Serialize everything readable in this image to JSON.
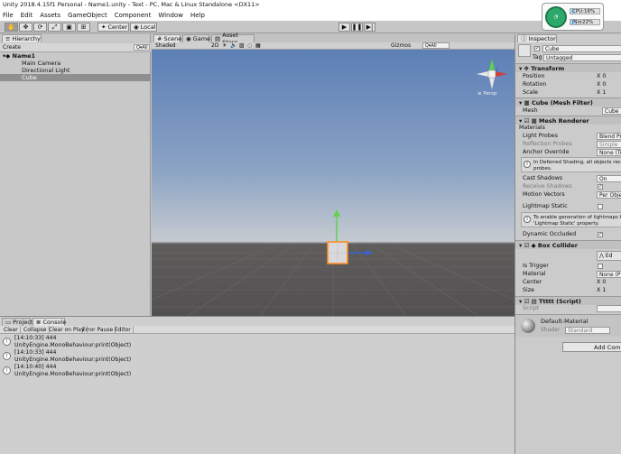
{
  "window": {
    "title": "Unity 2018.4.15f1 Personal - Name1.unity - Text - PC, Mac & Linux Standalone <DX11>"
  },
  "menu": [
    "File",
    "Edit",
    "Assets",
    "GameObject",
    "Component",
    "Window",
    "Help"
  ],
  "toolbar": {
    "pivot_mode": "Center",
    "pivot_rotation": "Local"
  },
  "sysmon": {
    "cpu": "CPU:16%",
    "mem": "内存22%",
    "cpu_value": 16,
    "mem_value": 22,
    "gauge_color": "#2ea86a"
  },
  "hierarchy": {
    "tab": "Hierarchy",
    "create": "Create",
    "search": "Q▾All",
    "scene": "Name1",
    "items": [
      "Main Camera",
      "Directional Light",
      "Cube"
    ]
  },
  "scene_view": {
    "tabs": [
      "Scene",
      "Game",
      "Asset Store"
    ],
    "shading": "Shaded",
    "mode_2d": "2D",
    "gizmos": "Gizmos",
    "search": "Q▾All",
    "persp": "≡ Persp"
  },
  "console": {
    "tabs": [
      "Project",
      "Console"
    ],
    "buttons": [
      "Clear",
      "Collapse",
      "Clear on Play",
      "Error Pause",
      "Editor"
    ],
    "logs": [
      {
        "line1": "[14:10:33] 444",
        "line2": "UnityEngine.MonoBehaviour:print(Object)"
      },
      {
        "line1": "[14:10:33] 444",
        "line2": "UnityEngine.MonoBehaviour:print(Object)"
      },
      {
        "line1": "[14:10:40] 444",
        "line2": "UnityEngine.MonoBehaviour:print(Object)"
      }
    ]
  },
  "inspector": {
    "tab": "Inspector",
    "object_name": "Cube",
    "tag_label": "Tag",
    "tag_value": "Untagged",
    "transform": {
      "title": "Transform",
      "position": "Position",
      "rotation": "Rotation",
      "scale": "Scale",
      "x0": "X 0",
      "x1": "X 1"
    },
    "mesh_filter": {
      "title": "Cube (Mesh Filter)",
      "mesh_label": "Mesh",
      "mesh_value": "Cube"
    },
    "mesh_renderer": {
      "title": "Mesh Renderer",
      "materials": "Materials",
      "light_probes": "Light Probes",
      "light_probes_val": "Blend Pr",
      "reflection_probes": "Reflection Probes",
      "reflection_val": "Simple",
      "anchor_override": "Anchor Override",
      "anchor_val": "None (Tr",
      "deferred_help_1": "In Deferred Shading, all objects recei",
      "deferred_help_2": "probes.",
      "cast_shadows": "Cast Shadows",
      "cast_val": "On",
      "receive_shadows": "Receive Shadows",
      "motion_vectors": "Motion Vectors",
      "motion_val": "Per Obje",
      "lightmap_static": "Lightmap Static",
      "lightmap_help_1": "To enable generation of lightmaps fo",
      "lightmap_help_2": "'Lightmap Static' property.",
      "dynamic_occluded": "Dynamic Occluded"
    },
    "box_collider": {
      "title": "Box Collider",
      "edit": "Ed",
      "is_trigger": "Is Trigger",
      "material": "Material",
      "material_val": "None (Ph",
      "center": "Center",
      "size": "Size",
      "x0": "X 0",
      "x1": "X 1"
    },
    "script": {
      "title": "Ttttt (Script)",
      "label": "Script"
    },
    "material": {
      "name": "Default-Material",
      "shader_label": "Shader",
      "shader_val": "Standard"
    },
    "add_component": "Add Comp"
  }
}
